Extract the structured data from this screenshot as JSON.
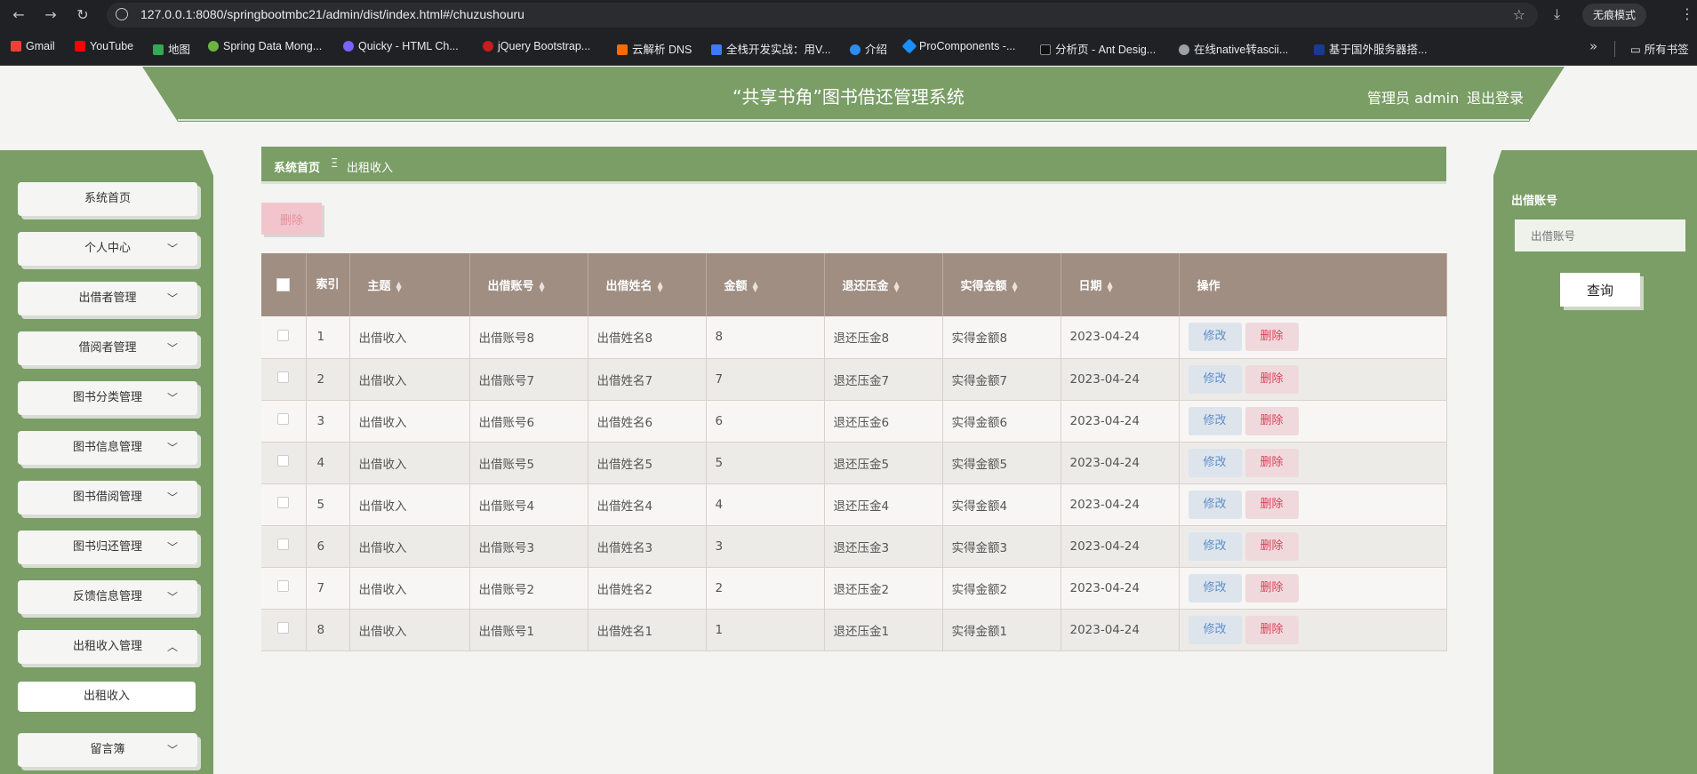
{
  "browser": {
    "url": "127.0.0.1:8080/springbootmbc21/admin/dist/index.html#/chuzushouru",
    "incognito_label": "无痕模式",
    "bookmarks": [
      "Gmail",
      "YouTube",
      "地图",
      "Spring Data Mong...",
      "Quicky - HTML Ch...",
      "jQuery Bootstrap...",
      "云解析 DNS",
      "全栈开发实战：用V...",
      "介绍",
      "ProComponents -...",
      "分析页 - Ant Desig...",
      "在线native转ascii...",
      "基于国外服务器搭..."
    ],
    "all_bookmarks_label": "所有书签"
  },
  "header": {
    "title": "“共享书角”图书借还管理系统",
    "admin_label": "管理员 admin",
    "logout_label": "退出登录"
  },
  "sidebar": {
    "items": [
      {
        "label": "系统首页"
      },
      {
        "label": "个人中心"
      },
      {
        "label": "出借者管理"
      },
      {
        "label": "借阅者管理"
      },
      {
        "label": "图书分类管理"
      },
      {
        "label": "图书信息管理"
      },
      {
        "label": "图书借阅管理"
      },
      {
        "label": "图书归还管理"
      },
      {
        "label": "反馈信息管理"
      },
      {
        "label": "出租收入管理"
      },
      {
        "label": "留言簿"
      }
    ],
    "sub_item": "出租收入"
  },
  "breadcrumb": {
    "home": "系统首页",
    "separator": "Ξ",
    "current": "出租收入"
  },
  "toolbar": {
    "batch_delete_label": "删除"
  },
  "search": {
    "label": "出借账号",
    "placeholder": "出借账号",
    "button_label": "查询"
  },
  "table": {
    "headers": {
      "index": "索引",
      "theme": "主题",
      "account": "出借账号",
      "name": "出借姓名",
      "amount": "金额",
      "deposit": "退还压金",
      "actual": "实得金额",
      "date": "日期",
      "ops": "操作"
    },
    "edit_label": "修改",
    "delete_label": "删除",
    "rows": [
      {
        "index": "1",
        "theme": "出借收入",
        "account": "出借账号8",
        "name": "出借姓名8",
        "amount": "8",
        "deposit": "退还压金8",
        "actual": "实得金额8",
        "date": "2023-04-24"
      },
      {
        "index": "2",
        "theme": "出借收入",
        "account": "出借账号7",
        "name": "出借姓名7",
        "amount": "7",
        "deposit": "退还压金7",
        "actual": "实得金额7",
        "date": "2023-04-24"
      },
      {
        "index": "3",
        "theme": "出借收入",
        "account": "出借账号6",
        "name": "出借姓名6",
        "amount": "6",
        "deposit": "退还压金6",
        "actual": "实得金额6",
        "date": "2023-04-24"
      },
      {
        "index": "4",
        "theme": "出借收入",
        "account": "出借账号5",
        "name": "出借姓名5",
        "amount": "5",
        "deposit": "退还压金5",
        "actual": "实得金额5",
        "date": "2023-04-24"
      },
      {
        "index": "5",
        "theme": "出借收入",
        "account": "出借账号4",
        "name": "出借姓名4",
        "amount": "4",
        "deposit": "退还压金4",
        "actual": "实得金额4",
        "date": "2023-04-24"
      },
      {
        "index": "6",
        "theme": "出借收入",
        "account": "出借账号3",
        "name": "出借姓名3",
        "amount": "3",
        "deposit": "退还压金3",
        "actual": "实得金额3",
        "date": "2023-04-24"
      },
      {
        "index": "7",
        "theme": "出借收入",
        "account": "出借账号2",
        "name": "出借姓名2",
        "amount": "2",
        "deposit": "退还压金2",
        "actual": "实得金额2",
        "date": "2023-04-24"
      },
      {
        "index": "8",
        "theme": "出借收入",
        "account": "出借账号1",
        "name": "出借姓名1",
        "amount": "1",
        "deposit": "退还压金1",
        "actual": "实得金额1",
        "date": "2023-04-24"
      }
    ]
  },
  "colors": {
    "theme_green": "#7a9e66",
    "table_header": "#a08e83",
    "edit_blue": "#5f8fc8",
    "delete_red": "#d9435a"
  }
}
